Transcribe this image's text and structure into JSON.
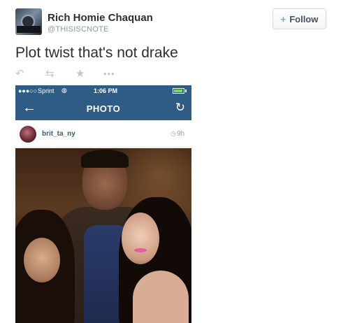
{
  "tweet": {
    "display_name": "Rich Homie Chaquan",
    "handle": "@THISISCNOTE",
    "follow_label": "Follow",
    "text": "Plot twist that's not drake"
  },
  "actions": {
    "reply_icon": "reply-icon",
    "retweet_icon": "retweet-icon",
    "favorite_icon": "star-icon",
    "more_icon": "more-icon"
  },
  "phone": {
    "status_bar": {
      "carrier": "Sprint",
      "time": "1:06 PM"
    },
    "nav": {
      "title": "PHOTO"
    },
    "post": {
      "username": "brit_ta_ny",
      "time": "9h"
    }
  },
  "colors": {
    "accent": "#55acee",
    "instagram_bar": "#2f5c85",
    "text": "#292f33",
    "muted": "#8899a6"
  }
}
